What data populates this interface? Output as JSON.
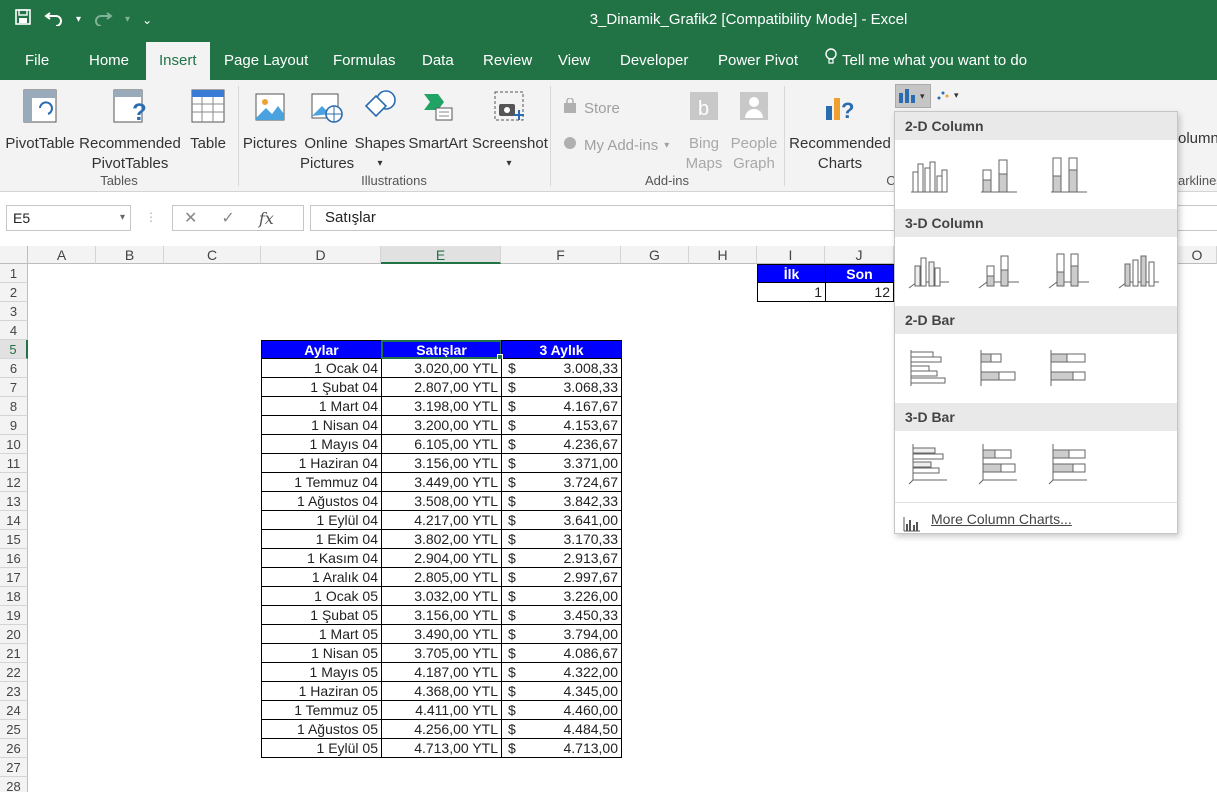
{
  "window": {
    "title": "3_Dinamik_Grafik2  [Compatibility Mode] - Excel"
  },
  "qat": {
    "save_icon": "save-icon",
    "undo_icon": "undo-icon",
    "redo_icon": "redo-icon",
    "customize_icon": "customize-qat-icon"
  },
  "tabs": [
    {
      "label": "File"
    },
    {
      "label": "Home"
    },
    {
      "label": "Insert"
    },
    {
      "label": "Page Layout"
    },
    {
      "label": "Formulas"
    },
    {
      "label": "Data"
    },
    {
      "label": "Review"
    },
    {
      "label": "View"
    },
    {
      "label": "Developer"
    },
    {
      "label": "Power Pivot"
    },
    {
      "label": "Tell me what you want to do"
    }
  ],
  "ribbon": {
    "tables": {
      "group_label": "Tables",
      "pivottable": "PivotTable",
      "recommended_pivot_1": "Recommended",
      "recommended_pivot_2": "PivotTables",
      "table": "Table"
    },
    "illustrations": {
      "group_label": "Illustrations",
      "pictures": "Pictures",
      "online_1": "Online",
      "online_2": "Pictures",
      "shapes": "Shapes",
      "smartart": "SmartArt",
      "screenshot": "Screenshot"
    },
    "addins": {
      "group_label": "Add-ins",
      "store": "Store",
      "my_addins": "My Add-ins",
      "bing_1": "Bing",
      "bing_2": "Maps",
      "people_1": "People",
      "people_2": "Graph"
    },
    "charts": {
      "rec_1": "Recommended",
      "rec_2": "Charts",
      "group_label_partial": "C",
      "column_partial": "olumn",
      "sparklines_partial": "arklines"
    }
  },
  "formula_bar": {
    "name_box": "E5",
    "cancel": "✕",
    "enter": "✓",
    "fx": "fx",
    "value": "Satışlar"
  },
  "columns": [
    "A",
    "B",
    "C",
    "D",
    "E",
    "F",
    "G",
    "H",
    "I",
    "J",
    "O"
  ],
  "rows": [
    "1",
    "2",
    "3",
    "4",
    "5",
    "6",
    "7",
    "8",
    "9",
    "10",
    "11",
    "12",
    "13",
    "14",
    "15",
    "16",
    "17",
    "18",
    "19",
    "20",
    "21",
    "22",
    "23",
    "24",
    "25",
    "26",
    "27",
    "28"
  ],
  "ij_table": {
    "header_i": "İlk",
    "header_j": "Son",
    "val_i": "1",
    "val_j": "12"
  },
  "data_table": {
    "headers": [
      "Aylar",
      "Satışlar",
      "3 Aylık"
    ],
    "currency": "$",
    "rows": [
      [
        "1 Ocak 04",
        "3.020,00 YTL",
        "3.008,33"
      ],
      [
        "1 Şubat 04",
        "2.807,00 YTL",
        "3.068,33"
      ],
      [
        "1 Mart 04",
        "3.198,00 YTL",
        "4.167,67"
      ],
      [
        "1 Nisan 04",
        "3.200,00 YTL",
        "4.153,67"
      ],
      [
        "1 Mayıs 04",
        "6.105,00 YTL",
        "4.236,67"
      ],
      [
        "1 Haziran 04",
        "3.156,00 YTL",
        "3.371,00"
      ],
      [
        "1 Temmuz 04",
        "3.449,00 YTL",
        "3.724,67"
      ],
      [
        "1 Ağustos 04",
        "3.508,00 YTL",
        "3.842,33"
      ],
      [
        "1 Eylül 04",
        "4.217,00 YTL",
        "3.641,00"
      ],
      [
        "1 Ekim 04",
        "3.802,00 YTL",
        "3.170,33"
      ],
      [
        "1 Kasım 04",
        "2.904,00 YTL",
        "2.913,67"
      ],
      [
        "1 Aralık 04",
        "2.805,00 YTL",
        "2.997,67"
      ],
      [
        "1 Ocak 05",
        "3.032,00 YTL",
        "3.226,00"
      ],
      [
        "1 Şubat 05",
        "3.156,00 YTL",
        "3.450,33"
      ],
      [
        "1 Mart 05",
        "3.490,00 YTL",
        "3.794,00"
      ],
      [
        "1 Nisan 05",
        "3.705,00 YTL",
        "4.086,67"
      ],
      [
        "1 Mayıs 05",
        "4.187,00 YTL",
        "4.322,00"
      ],
      [
        "1 Haziran 05",
        "4.368,00 YTL",
        "4.345,00"
      ],
      [
        "1 Temmuz 05",
        "4.411,00 YTL",
        "4.460,00"
      ],
      [
        "1 Ağustos 05",
        "4.256,00 YTL",
        "4.484,50"
      ],
      [
        "1 Eylül 05",
        "4.713,00 YTL",
        "4.713,00"
      ]
    ]
  },
  "dropdown": {
    "sections": [
      "2-D Column",
      "3-D Column",
      "2-D Bar",
      "3-D Bar"
    ],
    "more": "More Column Charts..."
  },
  "colors": {
    "excel_green": "#217346",
    "header_blue": "#0000ff"
  }
}
